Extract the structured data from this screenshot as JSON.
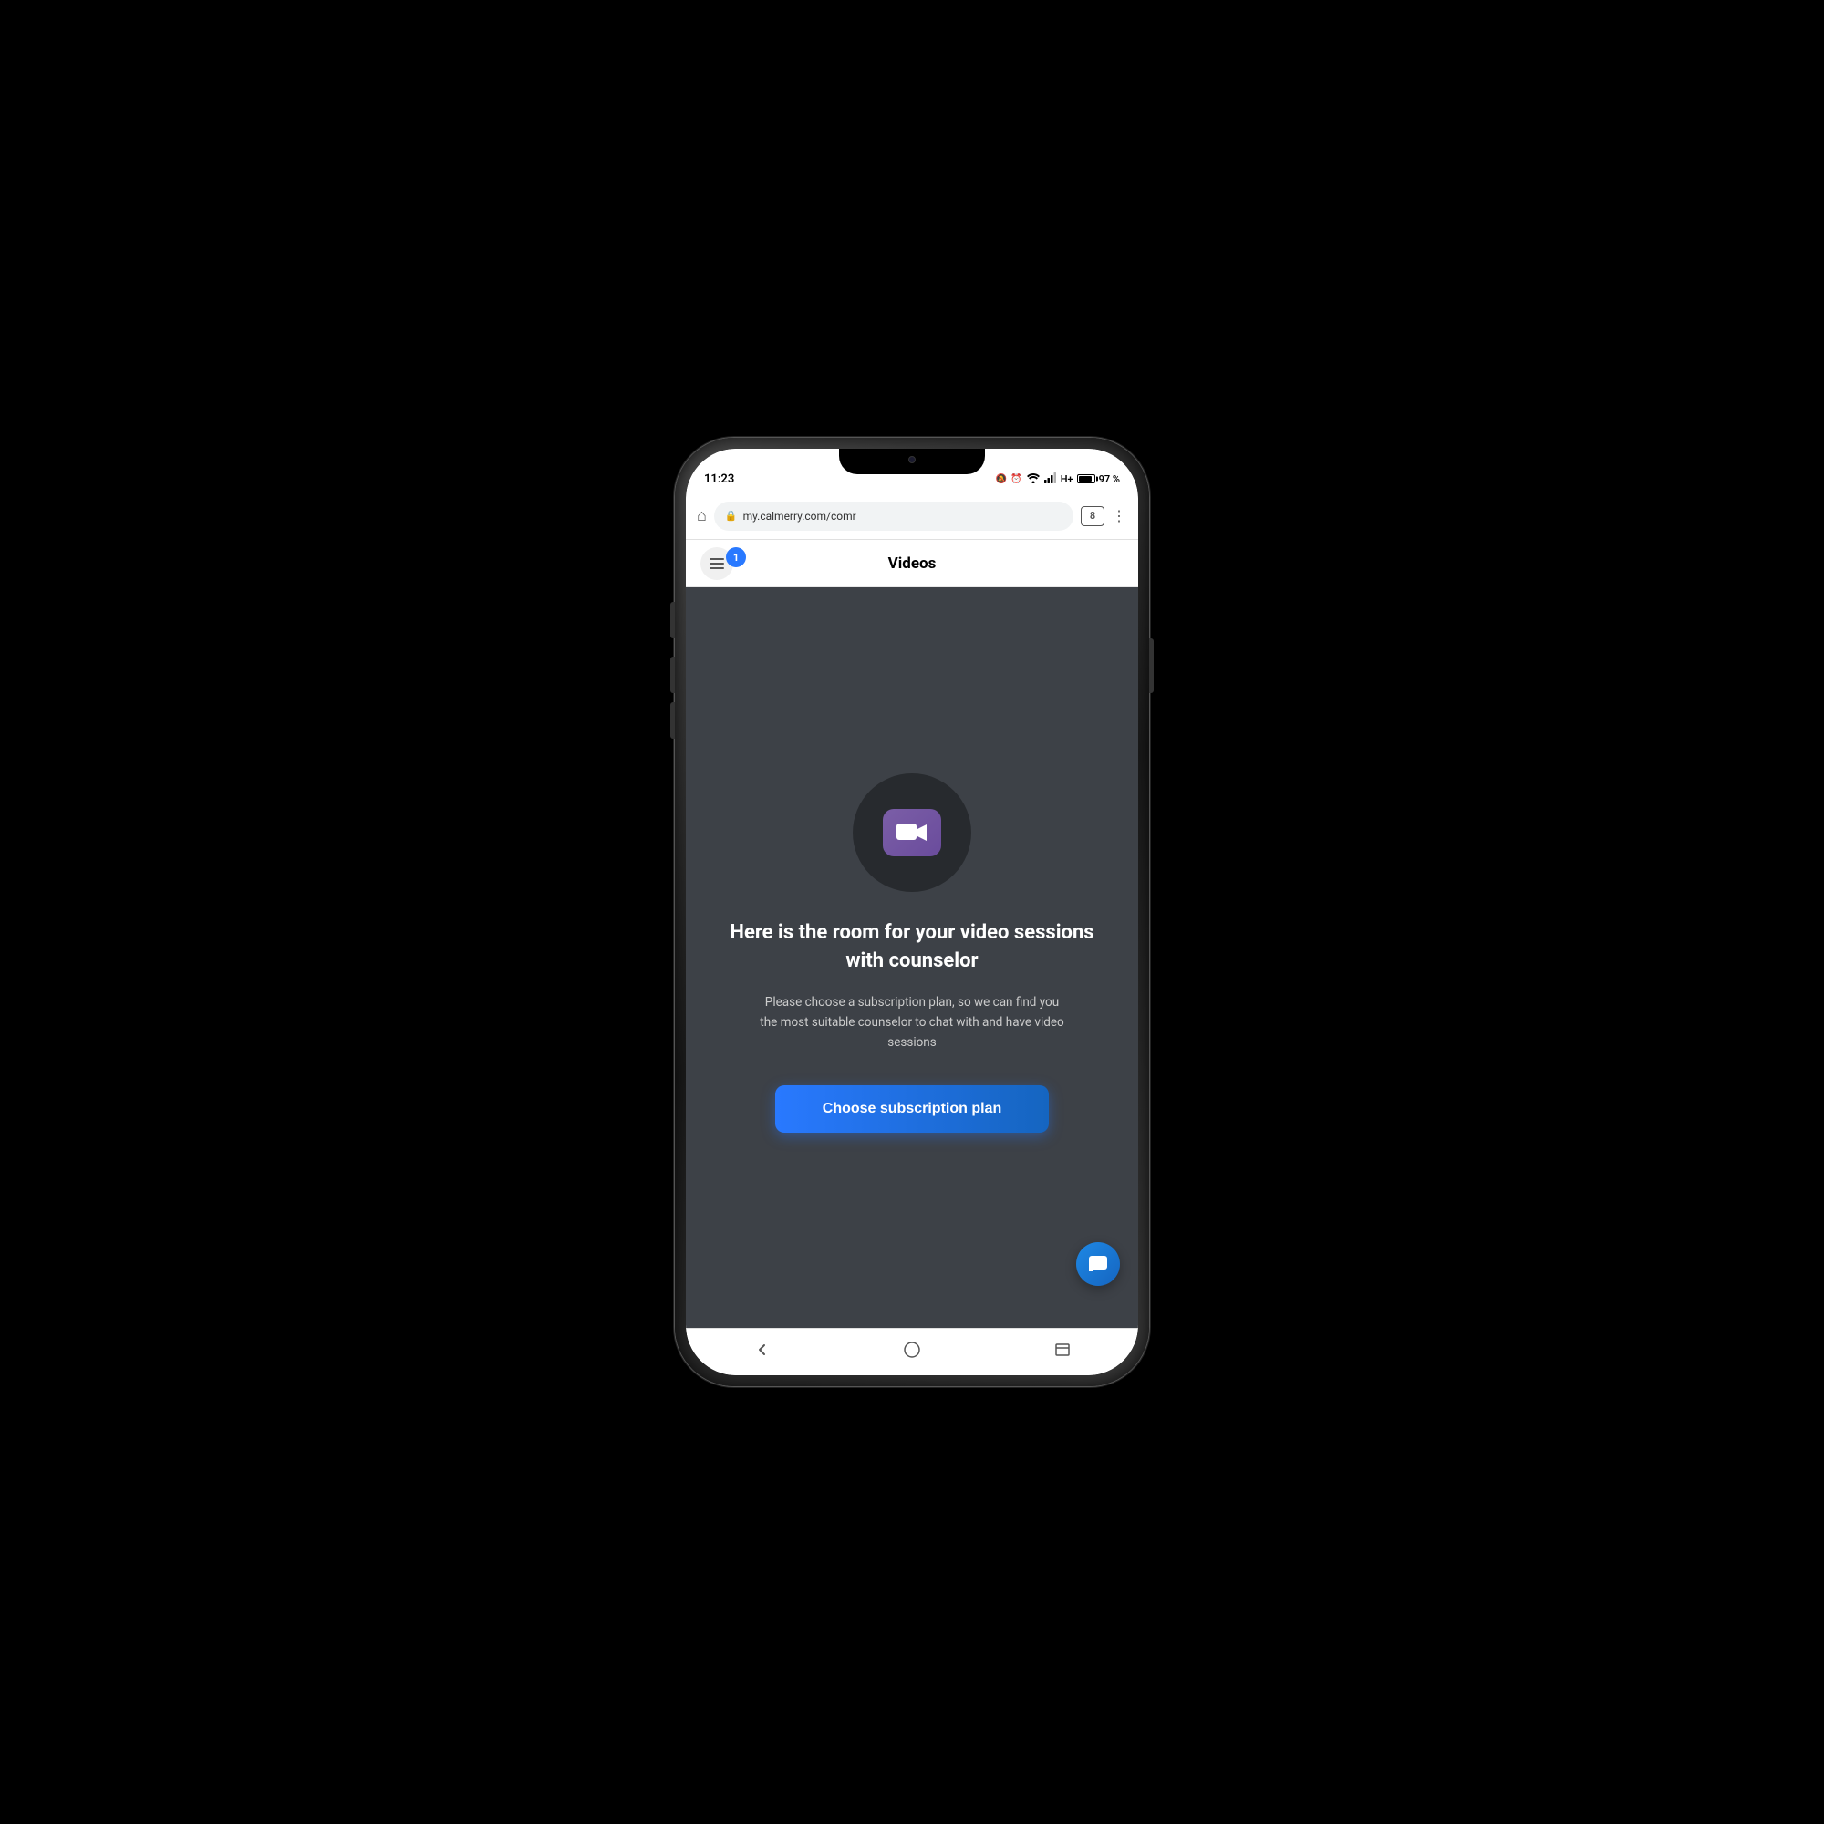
{
  "status_bar": {
    "time": "11:23",
    "battery_percent": "97 %",
    "signal": "H+"
  },
  "browser": {
    "url": "my.calmerry.com/comr",
    "tab_count": "8"
  },
  "app_header": {
    "title": "Videos",
    "notification_count": "1"
  },
  "main": {
    "heading": "Here is the room for your video sessions with counselor",
    "subtext": "Please choose a subscription plan, so we can find you the most suitable counselor to chat with and have video sessions",
    "cta_button_label": "Choose subscription plan"
  }
}
